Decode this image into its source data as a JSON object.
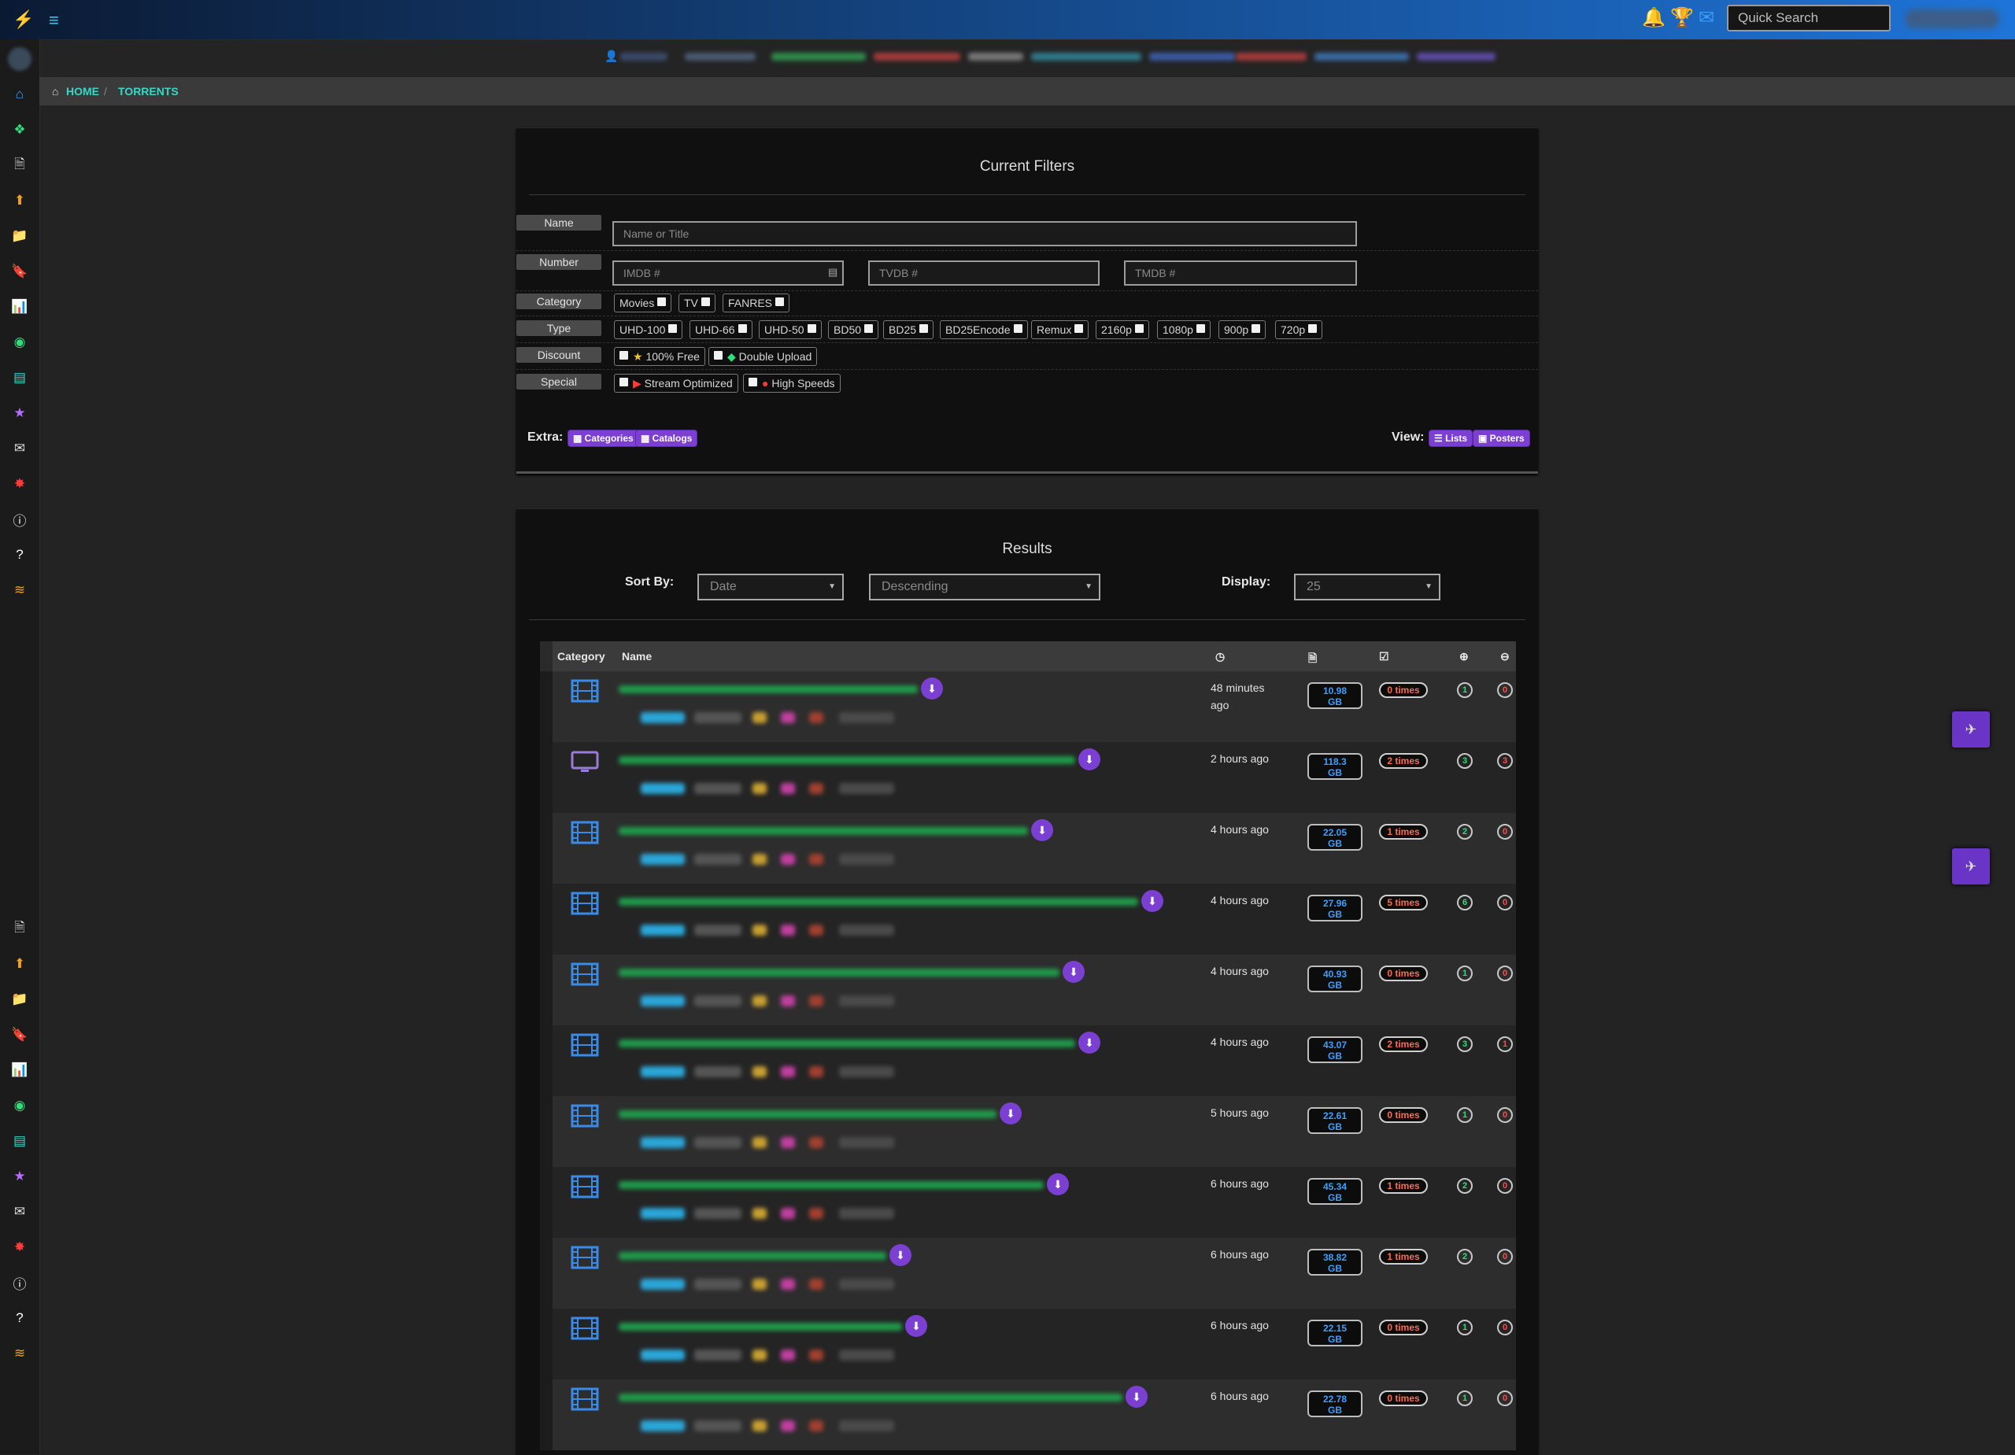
{
  "topbar": {
    "search_placeholder": "Quick Search"
  },
  "breadcrumb": {
    "home": "HOME",
    "separator": "/",
    "current": "TORRENTS"
  },
  "filters": {
    "title": "Current Filters",
    "labels": {
      "name": "Name",
      "number": "Number",
      "category": "Category",
      "type": "Type",
      "discount": "Discount",
      "special": "Special"
    },
    "name_placeholder": "Name or Title",
    "imdb_placeholder": "IMDB #",
    "tvdb_placeholder": "TVDB #",
    "tmdb_placeholder": "TMDB #",
    "categories": [
      "Movies",
      "TV",
      "FANRES"
    ],
    "types": [
      "UHD-100",
      "UHD-66",
      "UHD-50",
      "BD50",
      "BD25",
      "BD25Encode",
      "Remux",
      "2160p",
      "1080p",
      "900p",
      "720p"
    ],
    "discounts": [
      "100% Free",
      "Double Upload"
    ],
    "specials": [
      "Stream Optimized",
      "High Speeds"
    ],
    "extra_label": "Extra:",
    "extra_buttons": [
      "Categories",
      "Catalogs"
    ],
    "view_label": "View:",
    "view_buttons": [
      "Lists",
      "Posters"
    ]
  },
  "results": {
    "title": "Results",
    "sort_by_label": "Sort By:",
    "sort_field": "Date",
    "sort_order": "Descending",
    "display_label": "Display:",
    "display_count": "25",
    "columns": {
      "category": "Category",
      "name": "Name"
    },
    "rows": [
      {
        "category": "movie",
        "age_line1": "48 minutes",
        "age_line2": "ago",
        "size_num": "10.98",
        "size_unit": "GB",
        "times": "0 times",
        "seeders": "1",
        "leechers": "0"
      },
      {
        "category": "tv",
        "age_line1": "2 hours ago",
        "age_line2": "",
        "size_num": "118.3",
        "size_unit": "GB",
        "times": "2 times",
        "seeders": "3",
        "leechers": "3"
      },
      {
        "category": "movie",
        "age_line1": "4 hours ago",
        "age_line2": "",
        "size_num": "22.05",
        "size_unit": "GB",
        "times": "1 times",
        "seeders": "2",
        "leechers": "0"
      },
      {
        "category": "movie",
        "age_line1": "4 hours ago",
        "age_line2": "",
        "size_num": "27.96",
        "size_unit": "GB",
        "times": "5 times",
        "seeders": "6",
        "leechers": "0"
      },
      {
        "category": "movie",
        "age_line1": "4 hours ago",
        "age_line2": "",
        "size_num": "40.93",
        "size_unit": "GB",
        "times": "0 times",
        "seeders": "1",
        "leechers": "0"
      },
      {
        "category": "movie",
        "age_line1": "4 hours ago",
        "age_line2": "",
        "size_num": "43.07",
        "size_unit": "GB",
        "times": "2 times",
        "seeders": "3",
        "leechers": "1"
      },
      {
        "category": "movie",
        "age_line1": "5 hours ago",
        "age_line2": "",
        "size_num": "22.61",
        "size_unit": "GB",
        "times": "0 times",
        "seeders": "1",
        "leechers": "0"
      },
      {
        "category": "movie",
        "age_line1": "6 hours ago",
        "age_line2": "",
        "size_num": "45.34",
        "size_unit": "GB",
        "times": "1 times",
        "seeders": "2",
        "leechers": "0"
      },
      {
        "category": "movie",
        "age_line1": "6 hours ago",
        "age_line2": "",
        "size_num": "38.82",
        "size_unit": "GB",
        "times": "1 times",
        "seeders": "2",
        "leechers": "0"
      },
      {
        "category": "movie",
        "age_line1": "6 hours ago",
        "age_line2": "",
        "size_num": "22.15",
        "size_unit": "GB",
        "times": "0 times",
        "seeders": "1",
        "leechers": "0"
      },
      {
        "category": "movie",
        "age_line1": "6 hours ago",
        "age_line2": "",
        "size_num": "22.78",
        "size_unit": "GB",
        "times": "0 times",
        "seeders": "1",
        "leechers": "0"
      }
    ]
  },
  "sidebar_icons": [
    "home-icon",
    "award-icon",
    "file-icon",
    "upload-icon",
    "folder-icon",
    "bookmark-icon",
    "chart-icon",
    "globe-icon",
    "gift-icon",
    "star-icon",
    "mail-icon",
    "bug-icon",
    "info-icon",
    "help-icon",
    "rss-icon"
  ],
  "colors": {
    "accent": "#7b3fd2",
    "link": "#3ad6c7",
    "seed": "#2fe07a",
    "leech": "#ff4b4b",
    "size": "#3aa0ff"
  }
}
